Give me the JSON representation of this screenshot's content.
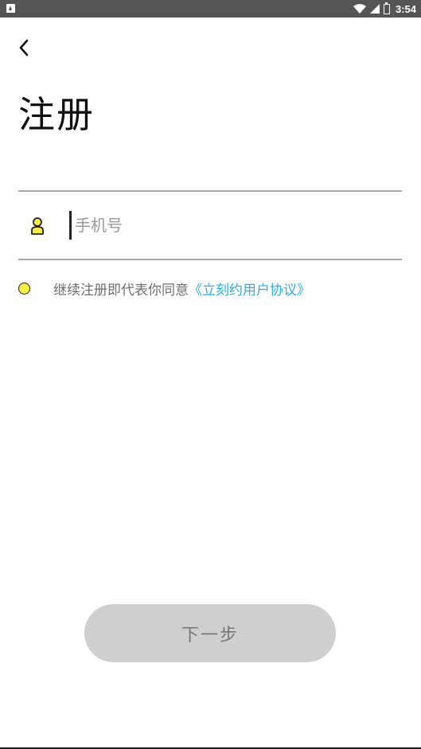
{
  "status_bar": {
    "time": "3:54",
    "icons": [
      "notification-icon",
      "wifi-icon",
      "signal-icon",
      "battery-icon"
    ]
  },
  "header": {
    "back_icon": "back-arrow-icon",
    "title": "注册"
  },
  "form": {
    "phone": {
      "icon": "user-icon",
      "placeholder": "手机号",
      "value": ""
    },
    "agreement": {
      "prefix": "继续注册即代表你同意",
      "link": "《立刻约用户协议》",
      "radio_color": "#f7ed45"
    }
  },
  "actions": {
    "next_label": "下一步",
    "next_bg": "#cfcfcf"
  },
  "colors": {
    "link": "#2aaee3",
    "status_bar": "#555555"
  }
}
